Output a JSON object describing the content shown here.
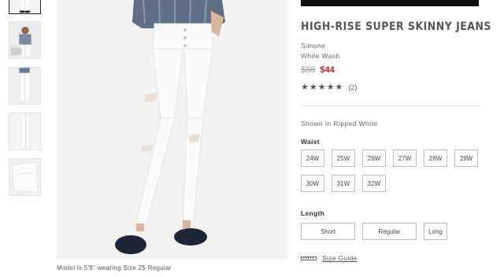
{
  "product": {
    "title": "HIGH-RISE SUPER SKINNY JEANS",
    "style_name": "Simone",
    "color_name": "White Wash",
    "price_original": "$88",
    "price_sale": "$44",
    "stars": "★★★★★",
    "review_count": "(2)",
    "shown_in": "Shown In Ripped White"
  },
  "waist": {
    "label": "Waist",
    "sizes": [
      "24W",
      "25W",
      "26W",
      "27W",
      "28W",
      "29W",
      "30W",
      "31W",
      "32W"
    ]
  },
  "length": {
    "label": "Length",
    "options": [
      "Short",
      "Regular",
      "Long"
    ]
  },
  "size_guide_label": "Size Guide",
  "model_caption": "Model is 5'9\" wearing Size 25 Regular",
  "colors": {
    "sale_price": "#c8102e",
    "top_bar": "#111111",
    "button_border": "#bdbdbd"
  }
}
